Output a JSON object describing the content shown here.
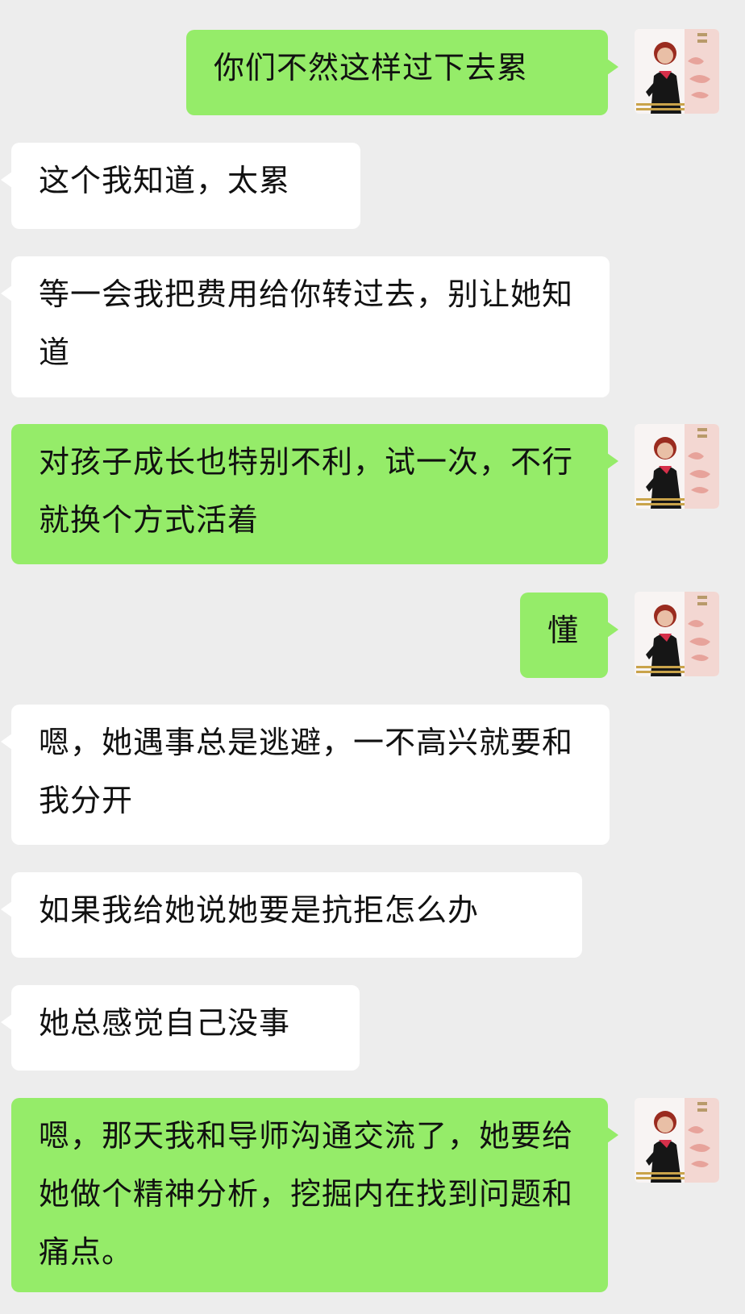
{
  "chat": {
    "messages": [
      {
        "sender": "self",
        "text": "你们不然这样过下去累"
      },
      {
        "sender": "other",
        "text": "这个我知道，太累"
      },
      {
        "sender": "other",
        "text": "等一会我把费用给你转过去，别让她知道"
      },
      {
        "sender": "self",
        "text": "对孩子成长也特别不利，试一次，不行就换个方式活着"
      },
      {
        "sender": "self",
        "text": "懂"
      },
      {
        "sender": "other",
        "text": "嗯，她遇事总是逃避，一不高兴就要和我分开"
      },
      {
        "sender": "other",
        "text": "如果我给她说她要是抗拒怎么办"
      },
      {
        "sender": "other",
        "text": "她总感觉自己没事"
      },
      {
        "sender": "self",
        "text": "嗯，那天我和导师沟通交流了，她要给她做个精神分析，挖掘内在找到问题和痛点。"
      }
    ],
    "avatar": {
      "icon": "profile-photo-woman",
      "colors": {
        "self_bubble": "#95ec69",
        "other_bubble": "#ffffff",
        "background": "#ededed"
      }
    }
  }
}
